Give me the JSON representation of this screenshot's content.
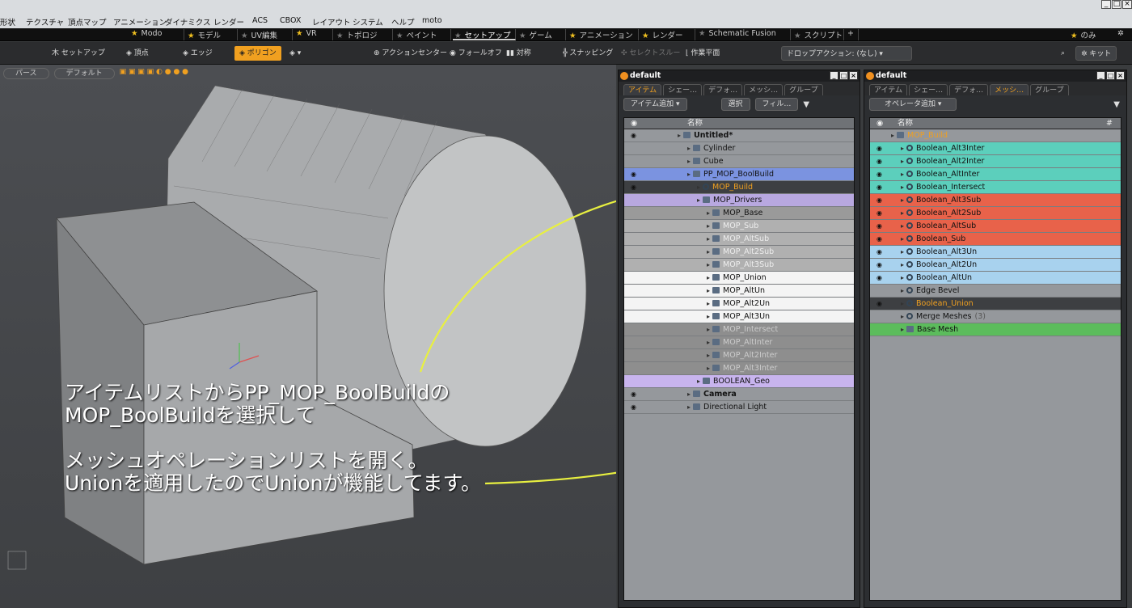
{
  "menu": [
    "形状",
    "テクスチャ",
    "頂点マップ",
    "アニメーション",
    "ダイナミクス",
    "レンダー",
    "ACS",
    "CBOX",
    "レイアウト",
    "システム",
    "ヘルプ",
    "moto"
  ],
  "layout_tabs": [
    {
      "label": "Modo",
      "starred": true
    },
    {
      "label": "モデル",
      "starred": true
    },
    {
      "label": "UV編集",
      "starred": false
    },
    {
      "label": "VR",
      "starred": true
    },
    {
      "label": "トポロジ",
      "starred": false
    },
    {
      "label": "ペイント",
      "starred": false
    },
    {
      "label": "セットアップ",
      "starred": false,
      "active": true
    },
    {
      "label": "ゲーム",
      "starred": false
    },
    {
      "label": "アニメーション",
      "starred": true
    },
    {
      "label": "レンダー",
      "starred": true
    },
    {
      "label": "Schematic Fusion",
      "starred": false
    },
    {
      "label": "スクリプト",
      "starred": false
    },
    {
      "label": "+"
    }
  ],
  "layout_right": {
    "only": "のみ"
  },
  "toolbar": {
    "setup": "セットアップ",
    "vertex": "頂点",
    "edge": "エッジ",
    "polygon": "ポリゴン",
    "action_center": "アクションセンター",
    "falloff": "フォールオフ",
    "symmetry": "対称",
    "snapping": "スナッピング",
    "select_through": "セレクトスルー",
    "workplane": "作業平面",
    "drop_action": "ドロップアクション: (なし)",
    "kit": "キット"
  },
  "viewport": {
    "perspective": "パース",
    "default": "デフォルト"
  },
  "overlay": [
    "アイテムリストからPP_MOP_BoolBuildの",
    "MOP_BoolBuildを選択して",
    "",
    "メッシュオペレーションリストを開く。",
    "Unionを適用したのでUnionが機能してます。"
  ],
  "panel_items": {
    "title": "default",
    "tabs": [
      "アイテム",
      "シェー…",
      "デフォ…",
      "メッシ…",
      "グループ"
    ],
    "add_button": "アイテム追加",
    "select_button": "選択",
    "filter_button": "フィル…",
    "header": "名称",
    "rows": [
      {
        "label": "Untitled*",
        "indent": 0,
        "bold": true,
        "bg": "#95989c",
        "eye": true,
        "icon": "scene"
      },
      {
        "label": "Cylinder",
        "indent": 1,
        "bg": "#95989c",
        "icon": "cube"
      },
      {
        "label": "Cube",
        "indent": 1,
        "bg": "#95989c",
        "icon": "cube"
      },
      {
        "label": "PP_MOP_BoolBuild",
        "indent": 1,
        "bg": "#7b93e0",
        "eye": true,
        "icon": "folder"
      },
      {
        "label": "MOP_Build",
        "indent": 2,
        "bg": "#3d3f42",
        "color": "#f0a020",
        "eye": true,
        "icon": "gear"
      },
      {
        "label": "MOP_Drivers",
        "indent": 2,
        "bg": "#b8a8e0",
        "icon": "folder"
      },
      {
        "label": "MOP_Base",
        "indent": 3,
        "bg": "#9a9a9a",
        "icon": "cube"
      },
      {
        "label": "MOP_Sub",
        "indent": 3,
        "bg": "#b0b0b0",
        "color": "#eee",
        "icon": "cube"
      },
      {
        "label": "MOP_AltSub",
        "indent": 3,
        "bg": "#b0b0b0",
        "color": "#eee",
        "icon": "cube"
      },
      {
        "label": "MOP_Alt2Sub",
        "indent": 3,
        "bg": "#b0b0b0",
        "color": "#eee",
        "icon": "cube"
      },
      {
        "label": "MOP_Alt3Sub",
        "indent": 3,
        "bg": "#b0b0b0",
        "color": "#eee",
        "icon": "cube"
      },
      {
        "label": "MOP_Union",
        "indent": 3,
        "bg": "#f4f4f4",
        "icon": "cube"
      },
      {
        "label": "MOP_AltUn",
        "indent": 3,
        "bg": "#f4f4f4",
        "icon": "cube"
      },
      {
        "label": "MOP_Alt2Un",
        "indent": 3,
        "bg": "#f4f4f4",
        "icon": "cube"
      },
      {
        "label": "MOP_Alt3Un",
        "indent": 3,
        "bg": "#f4f4f4",
        "icon": "cube"
      },
      {
        "label": "MOP_Intersect",
        "indent": 3,
        "bg": "#8e8e8e",
        "color": "#ccc",
        "icon": "cube"
      },
      {
        "label": "MOP_AltInter",
        "indent": 3,
        "bg": "#8e8e8e",
        "color": "#ccc",
        "icon": "cube"
      },
      {
        "label": "MOP_Alt2Inter",
        "indent": 3,
        "bg": "#8e8e8e",
        "color": "#ccc",
        "icon": "cube"
      },
      {
        "label": "MOP_Alt3Inter",
        "indent": 3,
        "bg": "#8e8e8e",
        "color": "#ccc",
        "icon": "cube"
      },
      {
        "label": "BOOLEAN_Geo",
        "indent": 2,
        "bg": "#c8b4ee",
        "icon": "folder"
      },
      {
        "label": "Camera",
        "indent": 1,
        "bold": true,
        "bg": "#95989c",
        "eye": true,
        "icon": "camera"
      },
      {
        "label": "Directional Light",
        "indent": 1,
        "bg": "#95989c",
        "eye": true,
        "icon": "light"
      }
    ]
  },
  "panel_meshops": {
    "title": "default",
    "tabs": [
      "アイテム",
      "シェー…",
      "デフォ…",
      "メッシ…",
      "グループ"
    ],
    "add_button": "オペレータ追加",
    "header": "名称",
    "header_num": "#",
    "rows": [
      {
        "label": "MOP_Build",
        "indent": 0,
        "bg": "#95989c",
        "color": "#f0a020",
        "icon": "cube",
        "eye": false
      },
      {
        "label": "Boolean_Alt3Inter",
        "indent": 1,
        "bg": "#5ccfbc",
        "eye": true,
        "icon": "gear"
      },
      {
        "label": "Boolean_Alt2Inter",
        "indent": 1,
        "bg": "#5ccfbc",
        "eye": true,
        "icon": "gear"
      },
      {
        "label": "Boolean_AltInter",
        "indent": 1,
        "bg": "#5ccfbc",
        "eye": true,
        "icon": "gear"
      },
      {
        "label": "Boolean_Intersect",
        "indent": 1,
        "bg": "#5ccfbc",
        "eye": true,
        "icon": "gear"
      },
      {
        "label": "Boolean_Alt3Sub",
        "indent": 1,
        "bg": "#e8624a",
        "eye": true,
        "icon": "gear"
      },
      {
        "label": "Boolean_Alt2Sub",
        "indent": 1,
        "bg": "#e8624a",
        "eye": true,
        "icon": "gear"
      },
      {
        "label": "Boolean_AltSub",
        "indent": 1,
        "bg": "#e8624a",
        "eye": true,
        "icon": "gear"
      },
      {
        "label": "Boolean_Sub",
        "indent": 1,
        "bg": "#e8624a",
        "eye": true,
        "icon": "gear"
      },
      {
        "label": "Boolean_Alt3Un",
        "indent": 1,
        "bg": "#a8d2ee",
        "eye": true,
        "icon": "gear"
      },
      {
        "label": "Boolean_Alt2Un",
        "indent": 1,
        "bg": "#a8d2ee",
        "eye": true,
        "icon": "gear"
      },
      {
        "label": "Boolean_AltUn",
        "indent": 1,
        "bg": "#a8d2ee",
        "eye": true,
        "icon": "gear"
      },
      {
        "label": "Edge Bevel",
        "indent": 1,
        "bg": "#95989c",
        "icon": "gear"
      },
      {
        "label": "Boolean_Union",
        "indent": 1,
        "bg": "#3d3f42",
        "color": "#f0a020",
        "eye": true,
        "icon": "gear"
      },
      {
        "label": "Merge Meshes",
        "suffix": "(3)",
        "indent": 1,
        "bg": "#95989c",
        "icon": "gear"
      },
      {
        "label": "Base Mesh",
        "indent": 1,
        "bg": "#5cbc5c",
        "icon": "cube"
      }
    ]
  },
  "colors": {
    "accent": "#f0a020",
    "arrow": "#e8f040"
  }
}
